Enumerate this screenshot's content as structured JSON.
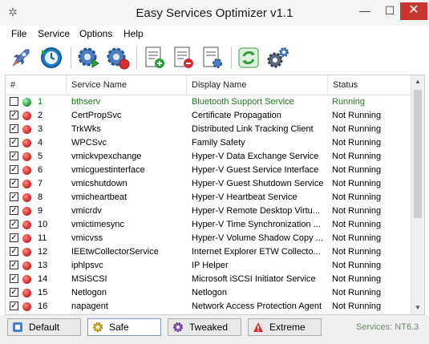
{
  "window": {
    "title": "Easy Services Optimizer v1.1",
    "icon": "gear-app-icon",
    "min": "—",
    "max": "☐",
    "close": "✕"
  },
  "menu": [
    "File",
    "Service",
    "Options",
    "Help"
  ],
  "toolbar": {
    "icons": [
      "optimize-rocket-icon",
      "restore-clock-icon",
      "start-service-icon",
      "stop-service-icon",
      "add-list-icon",
      "remove-list-icon",
      "list-settings-icon",
      "refresh-icon",
      "settings-gears-icon"
    ]
  },
  "table": {
    "headers": {
      "num": "#",
      "service": "Service Name",
      "display": "Display Name",
      "status": "Status"
    },
    "rows": [
      {
        "checked": false,
        "state": "green",
        "num": "1",
        "service": "bthserv",
        "display": "Bluetooth Support Service",
        "status": "Running"
      },
      {
        "checked": true,
        "state": "red",
        "num": "2",
        "service": "CertPropSvc",
        "display": "Certificate Propagation",
        "status": "Not Running"
      },
      {
        "checked": true,
        "state": "red",
        "num": "3",
        "service": "TrkWks",
        "display": "Distributed Link Tracking Client",
        "status": "Not Running"
      },
      {
        "checked": true,
        "state": "red",
        "num": "4",
        "service": "WPCSvc",
        "display": "Family Safety",
        "status": "Not Running"
      },
      {
        "checked": true,
        "state": "red",
        "num": "5",
        "service": "vmickvpexchange",
        "display": "Hyper-V Data Exchange Service",
        "status": "Not Running"
      },
      {
        "checked": true,
        "state": "red",
        "num": "6",
        "service": "vmicguestinterface",
        "display": "Hyper-V Guest Service Interface",
        "status": "Not Running"
      },
      {
        "checked": true,
        "state": "red",
        "num": "7",
        "service": "vmicshutdown",
        "display": "Hyper-V Guest Shutdown Service",
        "status": "Not Running"
      },
      {
        "checked": true,
        "state": "red",
        "num": "8",
        "service": "vmicheartbeat",
        "display": "Hyper-V Heartbeat Service",
        "status": "Not Running"
      },
      {
        "checked": true,
        "state": "red",
        "num": "9",
        "service": "vmicrdv",
        "display": "Hyper-V Remote Desktop Virtu...",
        "status": "Not Running"
      },
      {
        "checked": true,
        "state": "red",
        "num": "10",
        "service": "vmictimesync",
        "display": "Hyper-V Time Synchronization ...",
        "status": "Not Running"
      },
      {
        "checked": true,
        "state": "red",
        "num": "11",
        "service": "vmicvss",
        "display": "Hyper-V Volume Shadow Copy ...",
        "status": "Not Running"
      },
      {
        "checked": true,
        "state": "red",
        "num": "12",
        "service": "IEEtwCollectorService",
        "display": "Internet Explorer ETW Collecto...",
        "status": "Not Running"
      },
      {
        "checked": true,
        "state": "red",
        "num": "13",
        "service": "iphlpsvc",
        "display": "IP Helper",
        "status": "Not Running"
      },
      {
        "checked": true,
        "state": "red",
        "num": "14",
        "service": "MSiSCSI",
        "display": "Microsoft iSCSI Initiator Service",
        "status": "Not Running"
      },
      {
        "checked": true,
        "state": "red",
        "num": "15",
        "service": "Netlogon",
        "display": "Netlogon",
        "status": "Not Running"
      },
      {
        "checked": true,
        "state": "red",
        "num": "16",
        "service": "napagent",
        "display": "Network Access Protection Agent",
        "status": "Not Running"
      }
    ]
  },
  "profiles": [
    {
      "label": "Default",
      "icon": "default-icon",
      "active": false
    },
    {
      "label": "Safe",
      "icon": "safe-icon",
      "active": true
    },
    {
      "label": "Tweaked",
      "icon": "tweaked-icon",
      "active": false
    },
    {
      "label": "Extreme",
      "icon": "extreme-icon",
      "active": false
    }
  ],
  "statusbar": {
    "text": "Services: NT6.3"
  },
  "colors": {
    "running": "#1c7a1c",
    "stopped": "#d32f2f",
    "close_button": "#c7372f"
  }
}
